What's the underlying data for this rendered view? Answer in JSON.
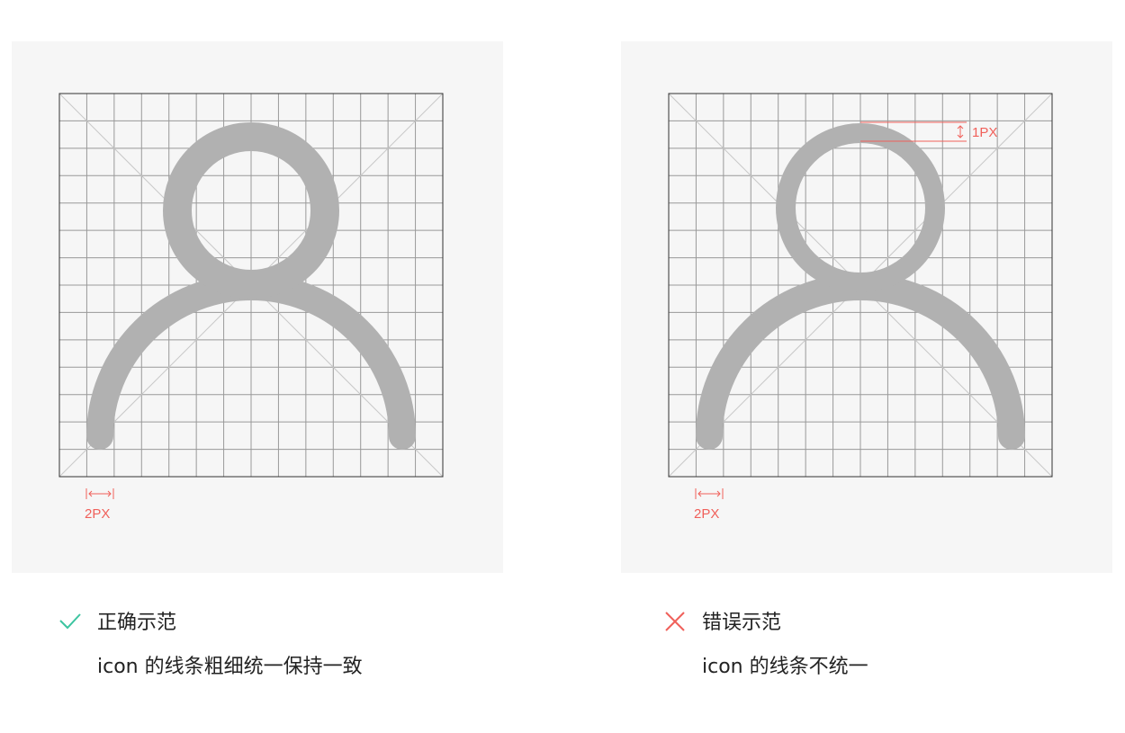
{
  "colors": {
    "panel_bg": "#f6f6f6",
    "grid_line": "#999999",
    "diagonal_line": "#c8c8c8",
    "frame_line": "#333333",
    "icon_fill": "#b1b1b1",
    "annotation": "#f0605a",
    "correct_mark": "#3cc4a0",
    "wrong_mark": "#f0605a",
    "text": "#222222"
  },
  "examples": [
    {
      "status": "correct",
      "mark_icon": "check-icon",
      "title": "正确示范",
      "description": "icon 的线条粗细统一保持一致",
      "stroke_annotation": "2PX"
    },
    {
      "status": "wrong",
      "mark_icon": "cross-icon",
      "title": "错误示范",
      "description": "icon 的线条不统一",
      "stroke_annotation": "2PX",
      "head_annotation": "1PX"
    }
  ]
}
